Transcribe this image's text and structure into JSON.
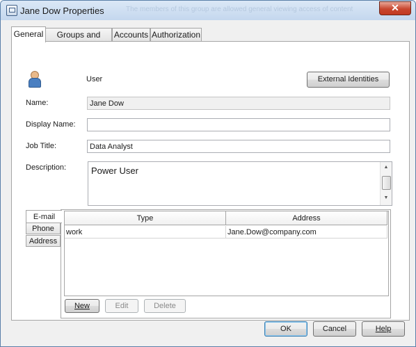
{
  "window": {
    "title": "Jane Dow Properties",
    "background_text": "The members of this group are allowed general viewing access of content",
    "close_glyph": "✕"
  },
  "tabs": [
    {
      "label": "General",
      "active": true
    },
    {
      "label": "Groups and Roles",
      "active": false
    },
    {
      "label": "Accounts",
      "active": false
    },
    {
      "label": "Authorization",
      "active": false
    }
  ],
  "general": {
    "user_type_label": "User",
    "external_identities_label": "External Identities",
    "name_label": "Name:",
    "name_value": "Jane Dow",
    "display_name_label": "Display Name:",
    "display_name_value": "",
    "job_title_label": "Job Title:",
    "job_title_value": "Data Analyst",
    "description_label": "Description:",
    "description_value": "Power User"
  },
  "contact": {
    "tabs": [
      {
        "label": "E-mail",
        "active": true
      },
      {
        "label": "Phone",
        "active": false
      },
      {
        "label": "Address",
        "active": false
      }
    ],
    "columns": [
      "Type",
      "Address"
    ],
    "rows": [
      {
        "type": "work",
        "address": "Jane.Dow@company.com"
      }
    ],
    "buttons": {
      "new": "New",
      "edit": "Edit",
      "delete": "Delete"
    }
  },
  "footer": {
    "ok": "OK",
    "cancel": "Cancel",
    "help": "Help"
  },
  "colors": {
    "accent": "#3c7fb1",
    "close_button": "#c23a22",
    "titlebar": "#c4d7ee"
  },
  "icons": {
    "app": "window-properties-icon",
    "user": "user-icon"
  }
}
